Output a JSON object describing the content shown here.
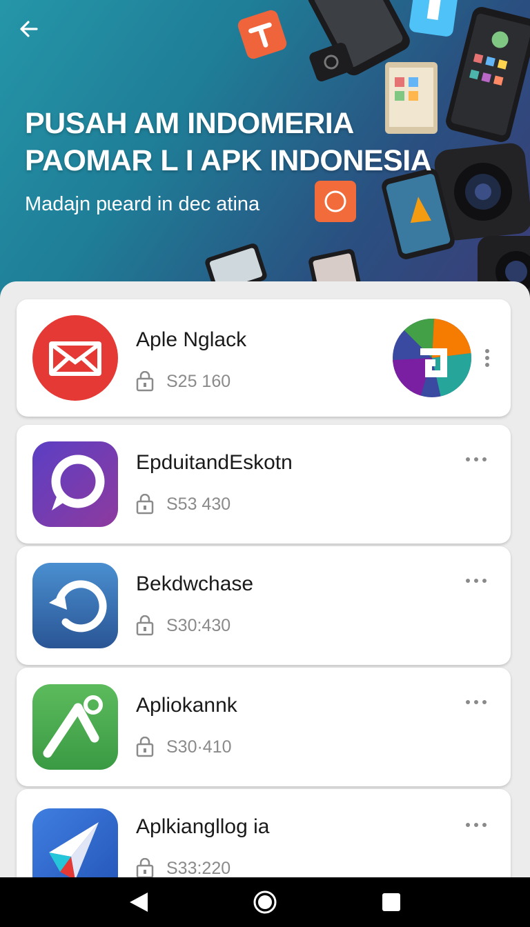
{
  "header": {
    "title_line1": "PUSAH AM INDOMERIA",
    "title_line2": "PAOMAR L I APK INDONESIA",
    "subtitle": "Madajn pɩeard in dec atina"
  },
  "apps": [
    {
      "name": "Aple Nglack",
      "price": "S25 160",
      "icon": "mail-icon"
    },
    {
      "name": "EpduitandEskotn",
      "price": "S53 430",
      "icon": "chat-bubble-icon"
    },
    {
      "name": "Bekdwchase",
      "price": "S30:430",
      "icon": "refresh-icon"
    },
    {
      "name": "Apliokannk",
      "price": "S30·410",
      "icon": "pick-tool-icon"
    },
    {
      "name": "Aplkiangllog ia",
      "price": "S33:220",
      "icon": "paper-plane-icon"
    }
  ],
  "colors": {
    "hero_start": "#2596a8",
    "hero_end": "#3d3c78",
    "mail_red": "#e53935",
    "purple": "#7b3bb5",
    "blue": "#2f6fb0",
    "green": "#43a047"
  }
}
